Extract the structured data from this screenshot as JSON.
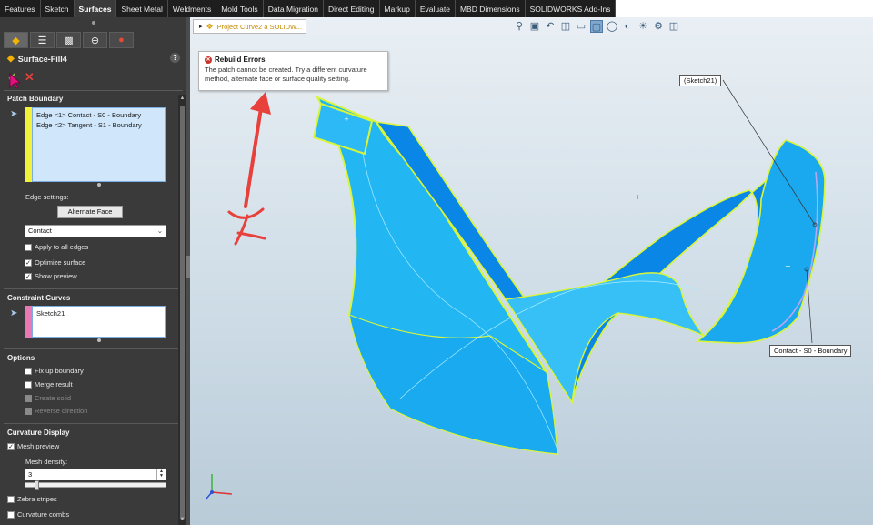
{
  "ribbon": {
    "tabs": [
      "Features",
      "Sketch",
      "Surfaces",
      "Sheet Metal",
      "Weldments",
      "Mold Tools",
      "Data Migration",
      "Direct Editing",
      "Markup",
      "Evaluate",
      "MBD Dimensions",
      "SOLIDWORKS Add-Ins"
    ],
    "active_tab": "Surfaces"
  },
  "property_manager": {
    "feature_title": "Surface-Fill4",
    "help_icon": "question-icon",
    "patch_boundary": {
      "title": "Patch Boundary",
      "edges": [
        "Edge <1> Contact - S0 - Boundary",
        "Edge <2> Tangent - S1 - Boundary"
      ],
      "edge_settings_label": "Edge settings:",
      "alternate_face_label": "Alternate Face",
      "curvature_select_value": "Contact",
      "apply_all_edges": {
        "label": "Apply to all edges",
        "checked": false
      },
      "optimize_surface": {
        "label": "Optimize surface",
        "checked": true
      },
      "show_preview": {
        "label": "Show preview",
        "checked": true
      }
    },
    "constraint_curves": {
      "title": "Constraint Curves",
      "items": [
        "Sketch21"
      ]
    },
    "options": {
      "title": "Options",
      "fix_up_boundary": {
        "label": "Fix up boundary",
        "checked": false
      },
      "merge_result": {
        "label": "Merge result",
        "checked": false
      },
      "create_solid": {
        "label": "Create solid",
        "checked": false,
        "disabled": true
      },
      "reverse_direction": {
        "label": "Reverse direction",
        "checked": false,
        "disabled": true
      }
    },
    "curvature_display": {
      "title": "Curvature Display",
      "mesh_preview": {
        "label": "Mesh preview",
        "checked": true
      },
      "mesh_density_label": "Mesh density:",
      "mesh_density_value": "3",
      "zebra_stripes": {
        "label": "Zebra stripes",
        "checked": false
      },
      "curvature_combs": {
        "label": "Curvature combs",
        "checked": false
      }
    }
  },
  "viewport": {
    "breadcrumb": "Project Curve2 a SOLIDW...",
    "rebuild_error": {
      "title": "Rebuild Errors",
      "message_lines": [
        "The patch cannot be created. Try a different curvature",
        "method, alternate face or surface quality setting."
      ]
    },
    "callouts": {
      "sketch": "(Sketch21)",
      "boundary": "Contact - S0 - Boundary"
    },
    "colors": {
      "surface_light": "#1eb1f0",
      "surface_dark": "#0a86e6",
      "edge_highlight": "#d9f53a",
      "annotation_red": "#e8403a",
      "constraint_curve": "#b9a8f0"
    }
  }
}
